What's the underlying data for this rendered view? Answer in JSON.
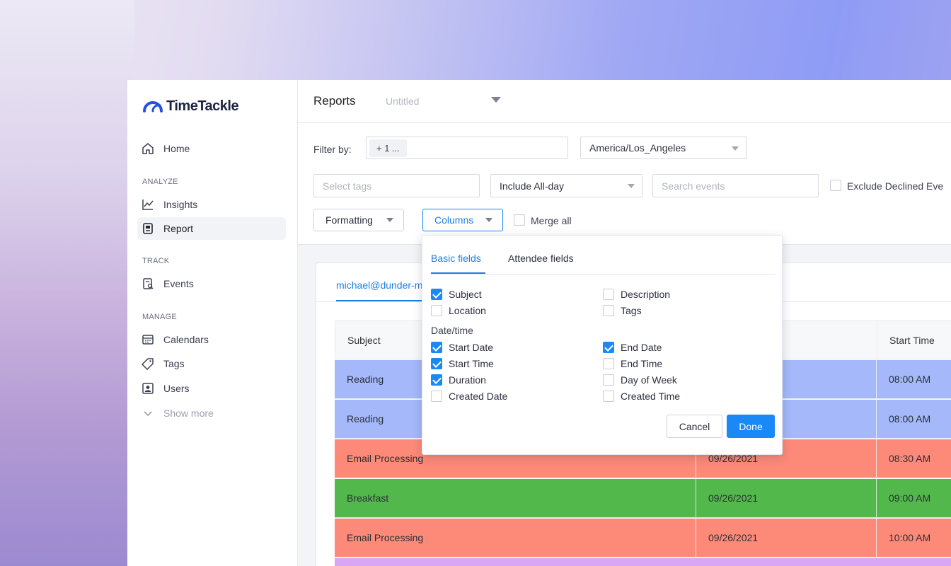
{
  "app": {
    "logo_text": "TimeTackle",
    "header_title": "Reports",
    "report_name_placeholder": "Untitled"
  },
  "sidebar": {
    "home": "Home",
    "section_analyze": "ANALYZE",
    "insights": "Insights",
    "report": "Report",
    "section_track": "TRACK",
    "events": "Events",
    "section_manage": "MANAGE",
    "calendars": "Calendars",
    "tags": "Tags",
    "users": "Users",
    "show_more": "Show more"
  },
  "filters": {
    "filter_by_label": "Filter by:",
    "filter_chip": "+ 1 ...",
    "timezone": "America/Los_Angeles",
    "tags_placeholder": "Select tags",
    "allday": "Include All-day",
    "search_placeholder": "Search events",
    "exclude_declined": "Exclude Declined Eve",
    "formatting": "Formatting",
    "columns": "Columns",
    "merge_all": "Merge all"
  },
  "content": {
    "account_tab": "michael@dunder-m",
    "table": {
      "headers": [
        "Subject",
        "",
        "Start Time"
      ],
      "rows": [
        {
          "subject": "Reading",
          "date": "",
          "time": "08:00 AM",
          "color": "#a4b8fa"
        },
        {
          "subject": "Reading",
          "date": "",
          "time": "08:00 AM",
          "color": "#a4b8fa"
        },
        {
          "subject": "Email Processing",
          "date": "09/26/2021",
          "time": "08:30 AM",
          "color": "#fd8a78"
        },
        {
          "subject": "Breakfast",
          "date": "09/26/2021",
          "time": "09:00 AM",
          "color": "#52b84b"
        },
        {
          "subject": "Email Processing",
          "date": "09/26/2021",
          "time": "10:00 AM",
          "color": "#fd8a78"
        }
      ]
    }
  },
  "columns_popover": {
    "tab_basic": "Basic fields",
    "tab_attendee": "Attendee fields",
    "section_datetime": "Date/time",
    "options": {
      "subject": {
        "label": "Subject",
        "checked": true
      },
      "description": {
        "label": "Description",
        "checked": false
      },
      "location": {
        "label": "Location",
        "checked": false
      },
      "tags": {
        "label": "Tags",
        "checked": false
      },
      "start_date": {
        "label": "Start Date",
        "checked": true
      },
      "end_date": {
        "label": "End Date",
        "checked": true
      },
      "start_time": {
        "label": "Start Time",
        "checked": true
      },
      "end_time": {
        "label": "End Time",
        "checked": false
      },
      "duration": {
        "label": "Duration",
        "checked": true
      },
      "day_of_week": {
        "label": "Day of Week",
        "checked": false
      },
      "created_date": {
        "label": "Created Date",
        "checked": false
      },
      "created_time": {
        "label": "Created Time",
        "checked": false
      }
    },
    "cancel": "Cancel",
    "done": "Done"
  },
  "colors": {
    "accent": "#1a88f5",
    "row_blue": "#a4b8fa",
    "row_red": "#fd8a78",
    "row_green": "#52b84b",
    "row_purple": "#d9a6f5"
  }
}
